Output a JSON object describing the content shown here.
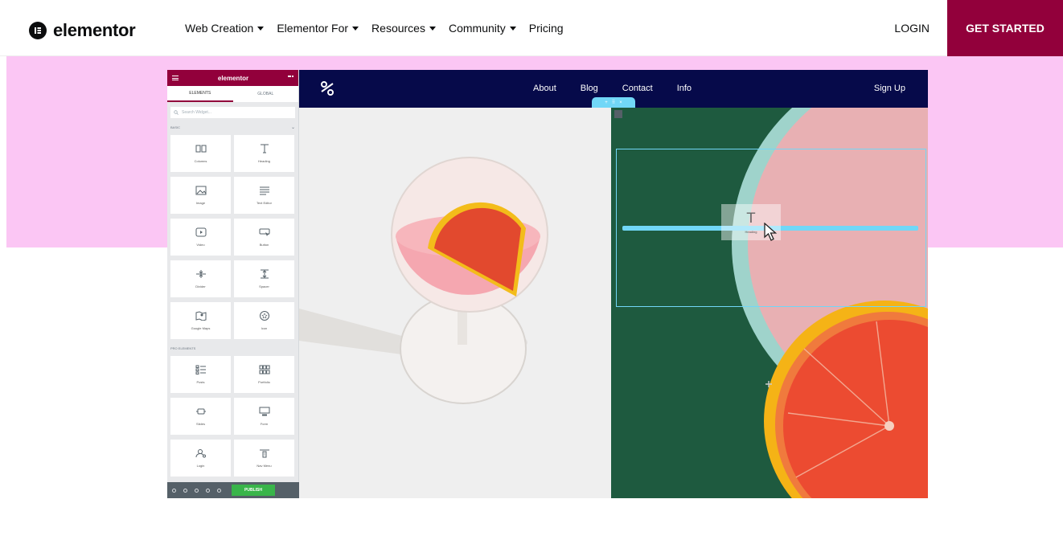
{
  "site_header": {
    "logo_text": "elementor",
    "menu": [
      {
        "label": "Web Creation",
        "has_caret": true
      },
      {
        "label": "Elementor For",
        "has_caret": true
      },
      {
        "label": "Resources",
        "has_caret": true
      },
      {
        "label": "Community",
        "has_caret": true
      },
      {
        "label": "Pricing",
        "has_caret": false
      }
    ],
    "login_label": "LOGIN",
    "cta_label": "GET STARTED",
    "cta_color": "#92003b"
  },
  "hero": {
    "band_color": "#fbc6f4"
  },
  "editor": {
    "panel": {
      "title": "elementor",
      "tabs": [
        "ELEMENTS",
        "GLOBAL"
      ],
      "search_placeholder": "Search Widget...",
      "basic_label": "BASIC",
      "pro_label": "PRO ELEMENTS",
      "basic_widgets": [
        {
          "label": "Columns",
          "icon": "columns-icon"
        },
        {
          "label": "Heading",
          "icon": "heading-icon"
        },
        {
          "label": "Image",
          "icon": "image-icon"
        },
        {
          "label": "Text Editor",
          "icon": "text-editor-icon"
        },
        {
          "label": "Video",
          "icon": "video-icon"
        },
        {
          "label": "Button",
          "icon": "button-icon"
        },
        {
          "label": "Divider",
          "icon": "divider-icon"
        },
        {
          "label": "Spacer",
          "icon": "spacer-icon"
        },
        {
          "label": "Google Maps",
          "icon": "map-icon"
        },
        {
          "label": "Icon",
          "icon": "star-icon"
        }
      ],
      "pro_widgets": [
        {
          "label": "Posts",
          "icon": "posts-icon"
        },
        {
          "label": "Portfolio",
          "icon": "portfolio-icon"
        },
        {
          "label": "Slides",
          "icon": "slides-icon"
        },
        {
          "label": "Form",
          "icon": "form-icon"
        },
        {
          "label": "Login",
          "icon": "login-icon"
        },
        {
          "label": "Nav Menu",
          "icon": "nav-menu-icon"
        }
      ],
      "publish_label": "PUBLISH"
    },
    "site": {
      "nav_links": [
        "About",
        "Blog",
        "Contact",
        "Info"
      ],
      "signup_label": "Sign Up"
    },
    "drag_widget_label": "Heading"
  }
}
